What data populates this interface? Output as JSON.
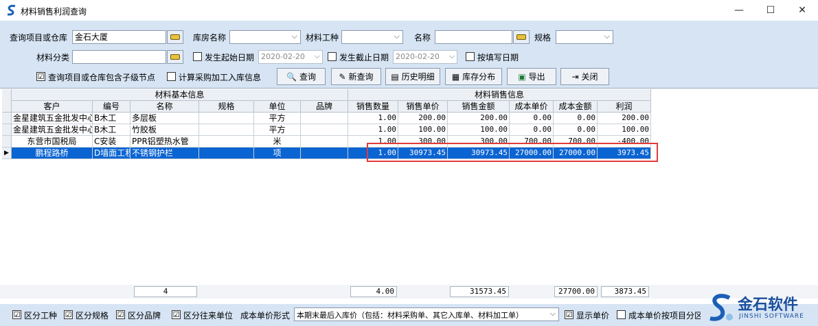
{
  "window": {
    "title": "材料销售利润查询",
    "minimize": "—",
    "maximize": "☐",
    "close": "✕"
  },
  "form": {
    "query_label": "查询项目或仓库",
    "query_value": "金石大厦",
    "warehouse_label": "库房名称",
    "material_type_label": "材料工种",
    "name_label": "名称",
    "spec_label": "规格",
    "category_label": "材料分类",
    "start_date_label": "发生起始日期",
    "start_date_value": "2020-02-20",
    "end_date_label": "发生截止日期",
    "end_date_value": "2020-02-20",
    "fill_date_label": "按填写日期",
    "include_sub_label": "查询项目或仓库包含子级节点",
    "include_sub_checked": "☑",
    "calc_purchase_label": "计算采购加工入库信息"
  },
  "buttons": {
    "query": "查询",
    "new_query": "新查询",
    "history": "历史明细",
    "stock": "库存分布",
    "export": "导出",
    "close": "关闭"
  },
  "grid": {
    "group_basic": "材料基本信息",
    "group_sales": "材料销售信息",
    "columns": [
      "客户",
      "编号",
      "名称",
      "规格",
      "单位",
      "品牌",
      "销售数量",
      "销售单价",
      "销售金额",
      "成本单价",
      "成本金额",
      "利润"
    ],
    "rows": [
      [
        "金星建筑五金批发中心",
        "B木工",
        "多层板",
        "",
        "平方",
        "",
        "1.00",
        "200.00",
        "200.00",
        "0.00",
        "0.00",
        "200.00"
      ],
      [
        "金星建筑五金批发中心",
        "B木工",
        "竹胶板",
        "",
        "平方",
        "",
        "1.00",
        "100.00",
        "100.00",
        "0.00",
        "0.00",
        "100.00"
      ],
      [
        "东营市国税局",
        "C安装",
        "PPR铝塑热水管",
        "",
        "米",
        "",
        "1.00",
        "300.00",
        "300.00",
        "700.00",
        "700.00",
        "-400.00"
      ],
      [
        "鹏程路桥",
        "D墙面工程",
        "不锈钢护栏",
        "",
        "项",
        "",
        "1.00",
        "30973.45",
        "30973.45",
        "27000.00",
        "27000.00",
        "3973.45"
      ]
    ],
    "selected_indicator": "▶"
  },
  "totals": {
    "count": "4",
    "qty": "4.00",
    "amount": "31573.45",
    "cost": "27700.00",
    "profit": "3873.45"
  },
  "bottom": {
    "by_type": "区分工种",
    "by_spec": "区分规格",
    "by_brand": "区分品牌",
    "by_partner": "区分往来单位",
    "cost_mode_label": "成本单价形式",
    "cost_mode_value": "本期末最后入库价（包括：材料采购单、其它入库单、材料加工单）",
    "show_price": "显示单价",
    "by_project": "成本单价按项目分区",
    "check": "☑"
  },
  "brand": {
    "name": "金石软件",
    "sub": "JINSHI SOFTWARE"
  },
  "colors": {
    "accent": "#0a64d2",
    "highlight": "#e23a3a",
    "panel": "#d6e4f4"
  }
}
